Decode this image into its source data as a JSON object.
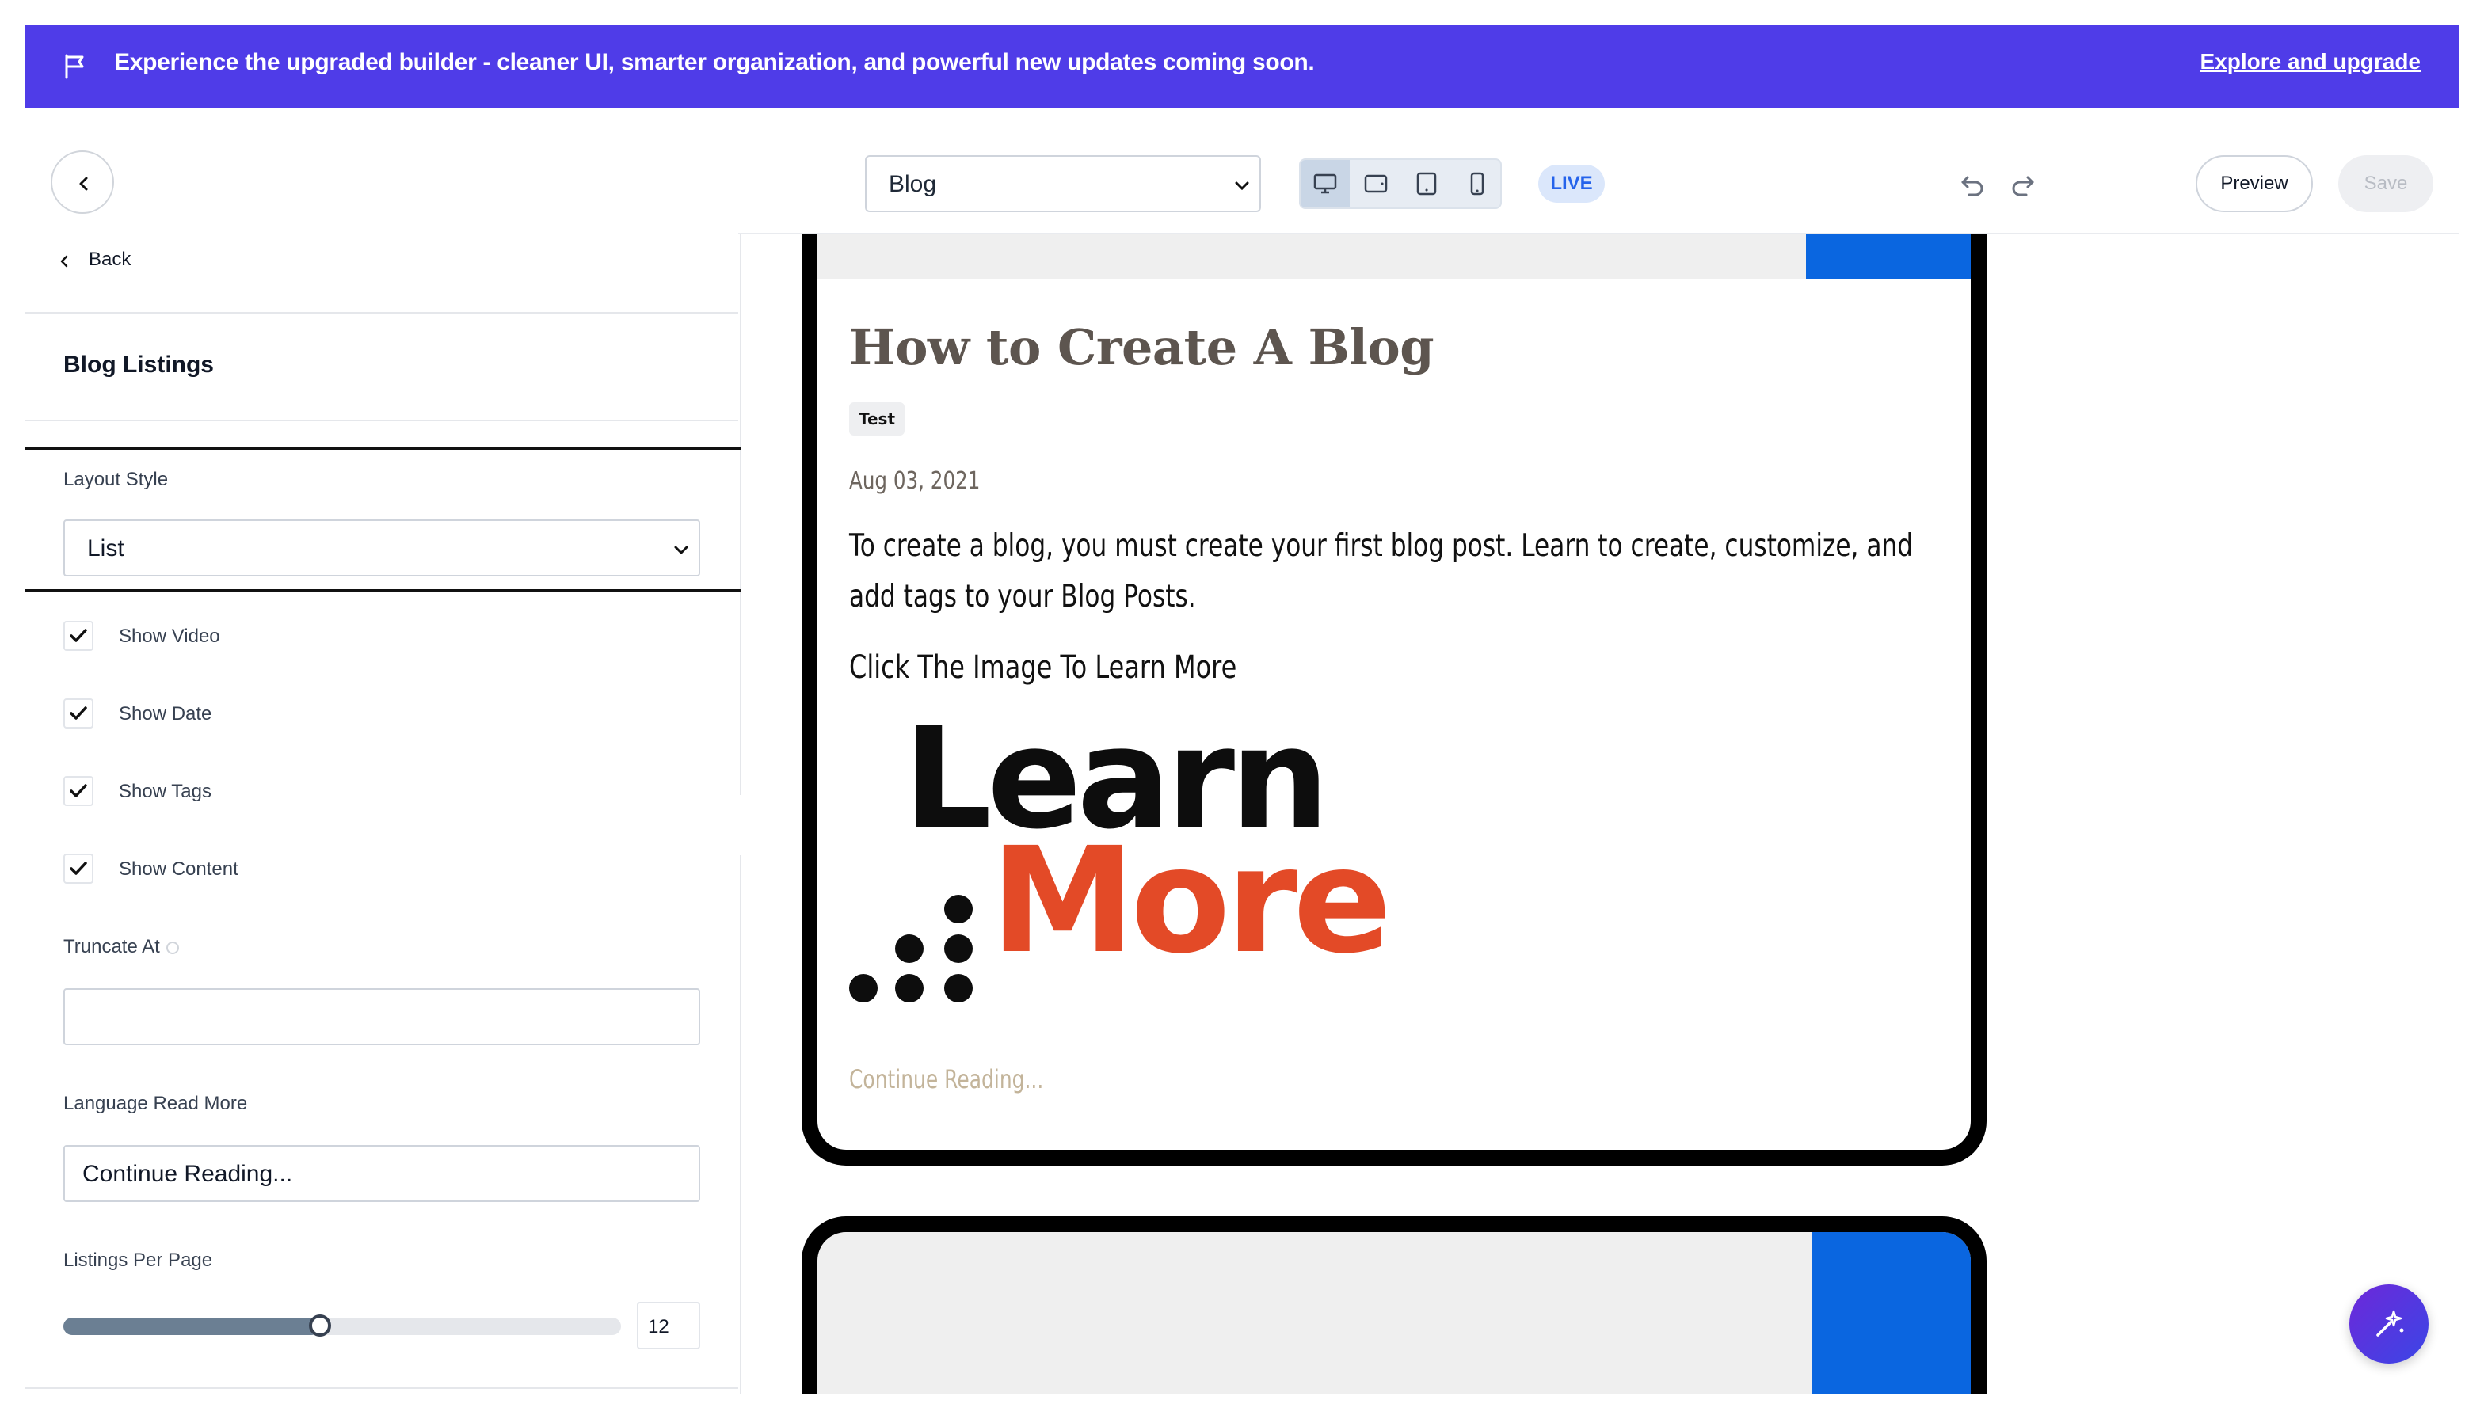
{
  "banner": {
    "icon": "flag-icon",
    "message": "Experience the upgraded builder - cleaner UI, smarter organization, and powerful new updates coming soon.",
    "link": "Explore and upgrade",
    "background": "#4f3ce8"
  },
  "topbar": {
    "page_select": "Blog",
    "devices": [
      "desktop-icon",
      "tablet-landscape-icon",
      "tablet-portrait-icon",
      "mobile-icon"
    ],
    "active_device": "desktop",
    "status": "LIVE",
    "preview_label": "Preview",
    "save_label": "Save"
  },
  "panel": {
    "back_label": "Back",
    "title": "Blog Listings",
    "layout_style": {
      "label": "Layout Style",
      "value": "List"
    },
    "checkboxes": [
      {
        "label": "Show Video",
        "checked": true
      },
      {
        "label": "Show Date",
        "checked": true
      },
      {
        "label": "Show Tags",
        "checked": true
      },
      {
        "label": "Show Content",
        "checked": true
      }
    ],
    "truncate": {
      "label": "Truncate At",
      "value": ""
    },
    "read_more": {
      "label": "Language Read More",
      "value": "Continue Reading..."
    },
    "per_page": {
      "label": "Listings Per Page",
      "value": "12",
      "slider_fraction": 0.46
    }
  },
  "post": {
    "title": "How to Create A Blog",
    "tag": "Test",
    "date": "Aug 03, 2021",
    "body": "To create a blog, you must create your first blog post. Learn to create, customize, and add tags to your Blog Posts.",
    "subheading": "Click The Image  To Learn More",
    "logo_line1": "Learn",
    "logo_line2": "More",
    "continue": "Continue Reading..."
  },
  "colors": {
    "accent_blue": "#0a66e0",
    "logo_orange": "#e34a27",
    "live_badge": "#2563eb"
  }
}
